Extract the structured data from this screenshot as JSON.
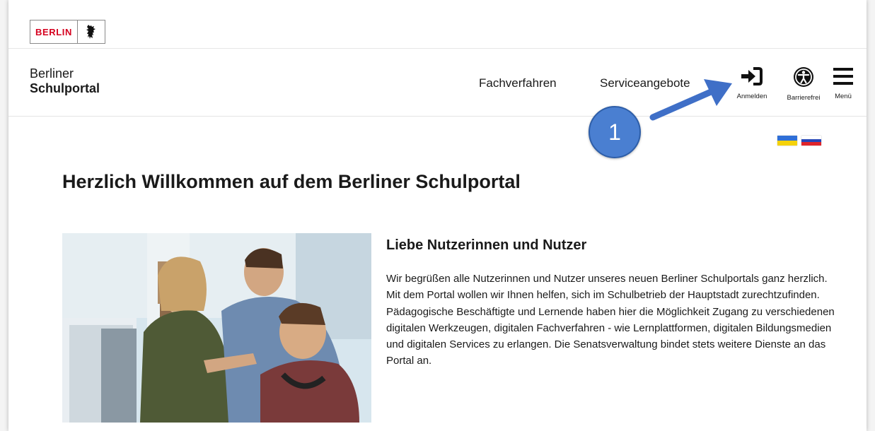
{
  "logo": {
    "text": "BERLIN",
    "emblem": "berlin-bear-icon"
  },
  "header": {
    "brand_line1": "Berliner",
    "brand_line2": "Schulportal",
    "nav": {
      "fachverfahren": "Fachverfahren",
      "serviceangebote": "Serviceangebote"
    },
    "tools": {
      "login": "Anmelden",
      "accessibility": "Barrierefrei",
      "menu": "Menü"
    }
  },
  "annotation": {
    "marker": "1"
  },
  "flags": [
    "ukraine-flag",
    "russia-flag"
  ],
  "main": {
    "title": "Herzlich Willkommen auf dem Berliner Schulportal",
    "section_title": "Liebe Nutzerinnen und Nutzer",
    "intro": "Wir begrüßen alle Nutzerinnen und Nutzer unseres neuen Berliner Schulportals ganz herzlich. Mit dem Portal wollen wir Ihnen helfen, sich im Schulbetrieb der Hauptstadt zurechtzufinden. Pädagogische Beschäftigte und Lernende haben hier die Möglichkeit Zugang zu verschiedenen digitalen Werkzeugen, digitalen Fachverfahren - wie Lernplattformen, digitalen Bildungsmedien und digitalen Services zu erlangen. Die Senatsverwaltung bindet stets weitere Dienste an das Portal an."
  },
  "colors": {
    "berlin_red": "#d5001f",
    "annotation_blue": "#4a7fd1"
  }
}
